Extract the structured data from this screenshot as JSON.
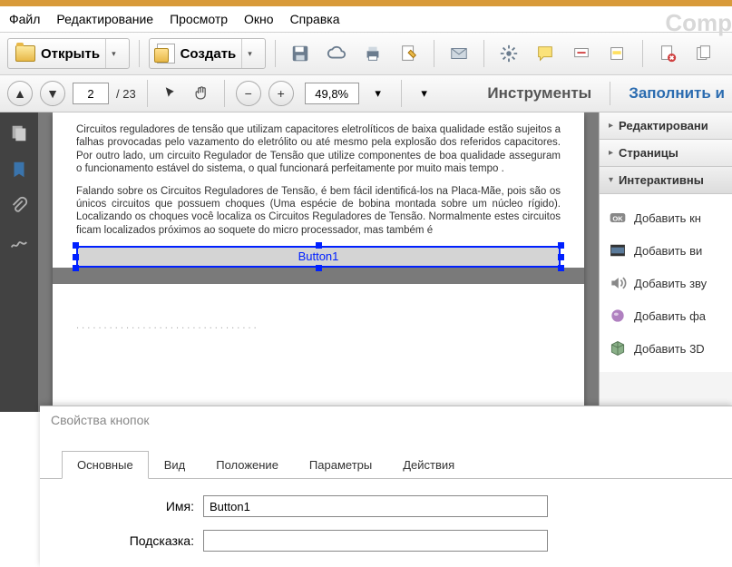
{
  "menu": {
    "file": "Файл",
    "edit": "Редактирование",
    "view": "Просмотр",
    "window": "Окно",
    "help": "Справка"
  },
  "watermark": "Comp",
  "toolbar": {
    "open": "Открыть",
    "create": "Создать"
  },
  "nav": {
    "page_current": "2",
    "page_total": "/ 23",
    "zoom": "49,8%"
  },
  "rightbar": {
    "tools": "Инструменты",
    "fill": "Заполнить и"
  },
  "doc": {
    "p1": "Circuitos reguladores de tensão que utilizam capacitores eletrolíticos de baixa qualidade estão sujeitos a falhas provocadas pelo vazamento do eletrólito ou até mesmo pela explosão dos referidos capacitores. Por outro lado, um circuito Regulador de Tensão que utilize componentes de boa qualidade asseguram o funcionamento estável do sistema, o qual funcionará perfeitamente por muito mais tempo .",
    "p2": "Falando sobre os Circuitos Reguladores de Tensão, é bem fácil identificá-los na Placa-Mãe, pois são os únicos circuitos que possuem choques (Uma espécie de bobina montada sobre um núcleo rígido). Localizando os choques você localiza os Circuitos Reguladores de Tensão. Normalmente estes circuitos ficam localizados próximos ao soquete do micro processador, mas também é",
    "button_label": "Button1"
  },
  "panel": {
    "s1": "Редактировани",
    "s2": "Страницы",
    "s3": "Интерактивны",
    "items": {
      "btn": "Добавить кн",
      "video": "Добавить ви",
      "audio": "Добавить зву",
      "file": "Добавить фа",
      "threeD": "Добавить 3D"
    }
  },
  "props": {
    "title": "Свойства кнопок",
    "tabs": {
      "main": "Основные",
      "view": "Вид",
      "position": "Положение",
      "params": "Параметры",
      "actions": "Действия"
    },
    "name_label": "Имя:",
    "name_value": "Button1",
    "hint_label": "Подсказка:",
    "hint_value": ""
  }
}
